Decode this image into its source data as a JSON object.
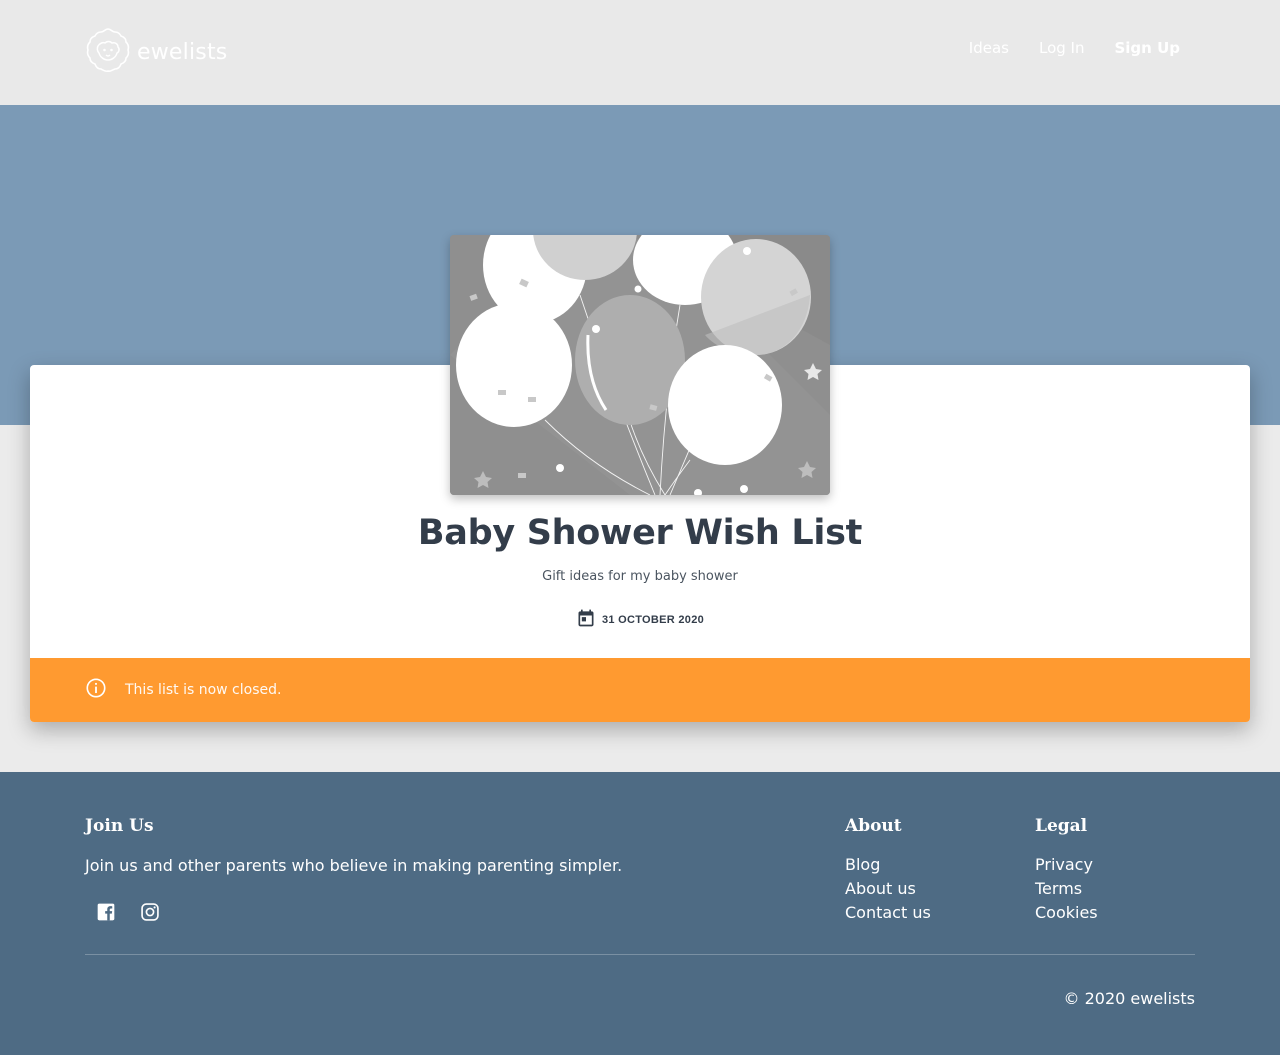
{
  "header": {
    "logo_text": "ewelists",
    "nav": [
      {
        "label": "Ideas"
      },
      {
        "label": "Log In"
      },
      {
        "label": "Sign Up"
      }
    ]
  },
  "list": {
    "title": "Baby Shower Wish List",
    "description": "Gift ideas for my baby shower",
    "date": "31 OCTOBER 2020",
    "image_icon": "balloons-illustration",
    "notice": "This list is now closed."
  },
  "footer": {
    "join": {
      "title": "Join Us",
      "text": "Join us and other parents who believe in making parenting simpler.",
      "social": [
        "facebook-icon",
        "instagram-icon"
      ]
    },
    "about": {
      "title": "About",
      "links": [
        "Blog",
        "About us",
        "Contact us"
      ]
    },
    "legal": {
      "title": "Legal",
      "links": [
        "Privacy",
        "Terms",
        "Cookies"
      ]
    },
    "copyright": "© 2020 ewelists"
  },
  "colors": {
    "header_bg": "#e9e9e9",
    "hero_bg": "#7b9ab6",
    "notice_bg": "#ff9a30",
    "footer_bg": "#4e6b84",
    "title_text": "#333d4a"
  }
}
